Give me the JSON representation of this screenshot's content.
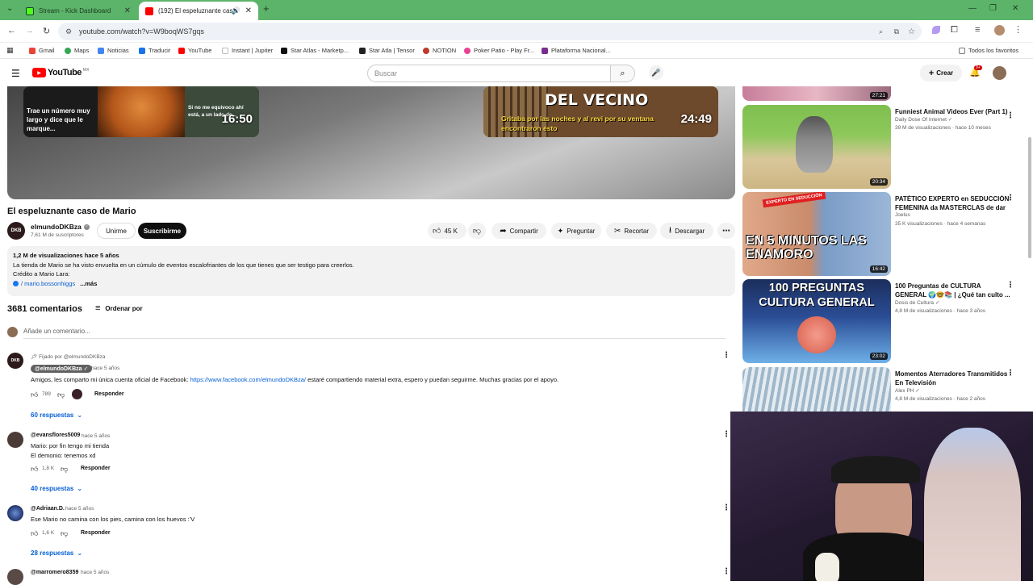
{
  "browser": {
    "tabs": [
      {
        "title": "Stream - Kick Dashboard"
      },
      {
        "title": "(192) El espeluznante caso"
      }
    ],
    "url": "youtube.com/watch?v=W9boqWS7gqs",
    "bookmarks": [
      "Gmail",
      "Maps",
      "Noticias",
      "Traducir",
      "YouTube",
      "Instant | Jupiter",
      "Star Atlas - Marketp...",
      "Star Atla | Tensor",
      "NOTION",
      "Poker Patio - Play Fr...",
      "Plataforma Nacional..."
    ],
    "bookmarks_all": "Todos los favoritos"
  },
  "youtube": {
    "logo": "YouTube",
    "logo_region": "MX",
    "search_placeholder": "Buscar",
    "create_label": "Crear",
    "notif_count": "9+"
  },
  "video": {
    "endcard1_text": "Trae un número muy largo y dice que le marque...",
    "endcard1_text2": "Si no me equivoco ahí está, a un lado de...",
    "endcard1_duration": "16:50",
    "endcard2_text": "DEL VECINO",
    "endcard2_text2": "Gritaba por las noches y al revi por su ventana encontraron esto",
    "endcard2_duration": "24:49",
    "title": "El espeluznante caso de Mario",
    "channel": "elmundoDKBza",
    "channel_avatar_text": "DKB",
    "subscribers": "7,61 M de suscriptores",
    "join_label": "Unirme",
    "subscribe_label": "Suscribirme",
    "likes": "45 K",
    "share_label": "Compartir",
    "ask_label": "Preguntar",
    "clip_label": "Recortar",
    "download_label": "Descargar",
    "views_date": "1,2 M de visualizaciones  hace 5 años",
    "description_line1": "La tienda de Mario se ha visto envuelta en un cúmulo de eventos escalofriantes de los que tienes que ser testigo para creerlos.",
    "description_line2": "Crédito a Mario Lara:",
    "description_link": "/ mario.bossonhiggs",
    "description_more": "...más"
  },
  "comments": {
    "count": "3681 comentarios",
    "sort_label": "Ordenar por",
    "add_placeholder": "Añade un comentario...",
    "items": [
      {
        "pinned": "Fijado por @elmundoDKBza",
        "author": "@elmundoDKBza",
        "time": "hace 5 años",
        "text_before": "Amigos, les comparto mi única cuenta oficial de Facebook:",
        "link": "https://www.facebook.com/elmundoDKBza/",
        "text_after": "estaré compartiendo material extra, espero y puedan seguirme. Muchas gracias por el apoyo.",
        "likes": "789",
        "reply_label": "Responder",
        "replies": "60 respuestas"
      },
      {
        "author": "@evansflores5009",
        "time": "hace 5 años",
        "line1": "Mario: por fin tengo mi tienda",
        "line2": "El demonio: tenemos xd",
        "likes": "1,8 K",
        "reply_label": "Responder",
        "replies": "40 respuestas"
      },
      {
        "author": "@Adriaan.D.",
        "time": "hace 5 años",
        "line1": "Ese Mario no camina con los pies, camina con los huevos :'V",
        "likes": "1,6 K",
        "reply_label": "Responder",
        "replies": "28 respuestas"
      },
      {
        "author": "@marromero8359",
        "time": "hace 5 años"
      }
    ]
  },
  "recommendations": [
    {
      "duration": "27:21"
    },
    {
      "title": "Funniest Animal Videos Ever (Part 1)",
      "channel": "Daily Dose Of Internet",
      "meta": "39 M de visualizaciones · hace 10 meses",
      "duration": "20:34"
    },
    {
      "title": "PATÉTICO EXPERTO en SEDUCCIÓN FEMENINA da MASTERCLAS de dar ...",
      "channel": "Joelus",
      "meta": "35 K visualizaciones · hace 4 semanas",
      "duration": "16:42",
      "thumb_text": "EN 5 MINUTOS LAS ENAMORO",
      "thumb_badge": "EXPERTO EN SEDUCCIÓN"
    },
    {
      "title": "100 Preguntas de CULTURA GENERAL 🌍🤓📚 | ¿Qué tan culto ...",
      "channel": "Dosis de Cultura",
      "meta": "4,8 M de visualizaciones · hace 3 años",
      "duration": "23:02",
      "thumb_text": "100 PREGUNTAS CULTURA GENERAL"
    },
    {
      "title": "Momentos Aterradores Transmitidos En Televisión",
      "channel": "Alex PH",
      "meta": "4,8 M de visualizaciones · hace 2 años"
    }
  ]
}
